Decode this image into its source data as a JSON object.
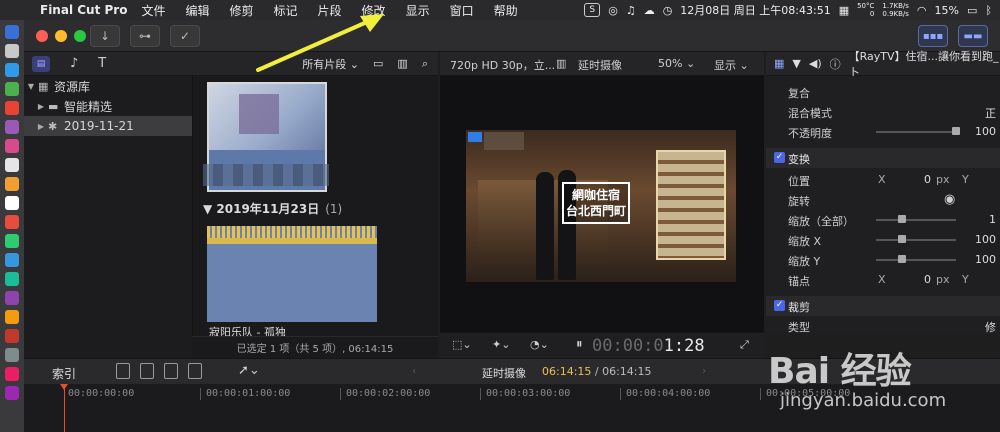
{
  "menubar": {
    "app_name": "Final Cut Pro",
    "items": [
      "文件",
      "编辑",
      "修剪",
      "标记",
      "片段",
      "修改",
      "显示",
      "窗口",
      "帮助"
    ],
    "status": {
      "temp": "50°C",
      "temp2": "0",
      "net_up": "1.7KB/s",
      "net_down": "0.9KB/s",
      "battery": "15%",
      "datetime": "12月08日 周日 上午08:43:51"
    }
  },
  "sidebar": {
    "library_label": "资源库",
    "items": [
      {
        "label": "智能精选"
      },
      {
        "label": "2019-11-21"
      }
    ]
  },
  "browser": {
    "filter_label": "所有片段 ⌄",
    "group_label": "2019年11月23日",
    "group_count": "(1)",
    "clip_name": "寂阳乐队 - 孤独",
    "footer": "已选定 1 项（共 5 项）, 06:14:15"
  },
  "viewer": {
    "format": "720p HD 30p，立...",
    "project_name": "延时摄像",
    "zoom": "50% ⌄",
    "display_label": "显示 ⌄",
    "overlay_line1": "網咖住宿",
    "overlay_line2": "台北西門町",
    "timecode_dim": "00:00:0",
    "timecode_bright": "1:28"
  },
  "inspector": {
    "clip_title": "【RayTV】住宿...讓你看到跑_卜",
    "rows": {
      "composite": "复合",
      "blend_mode": "混合模式",
      "blend_val": "正",
      "opacity": "不透明度",
      "opacity_val": "100",
      "transform": "变换",
      "position": "位置",
      "x_axis": "X",
      "pos_x_val": "0",
      "px": "px",
      "y_axis": "Y",
      "rotation": "旋转",
      "scale_all": "缩放（全部）",
      "scale_all_val": "1",
      "scale_x": "缩放 X",
      "scale_x_val": "100",
      "scale_y": "缩放 Y",
      "scale_y_val": "100",
      "anchor": "锚点",
      "anchor_x_val": "0",
      "crop": "裁剪",
      "type": "类型",
      "type_val": "修"
    }
  },
  "timeline": {
    "index_label": "索引",
    "project_name": "延时摄像",
    "tc_current": "06:14:15",
    "tc_total": "/ 06:14:15",
    "ruler": [
      "00:00:00:00",
      "00:00:01:00:00",
      "00:00:02:00:00",
      "00:00:03:00:00",
      "00:00:04:00:00",
      "00:00:05:00:00"
    ]
  },
  "watermark": {
    "main": "Bai 经验",
    "sub": "jingyan.baidu.com"
  },
  "colors": {
    "accent": "#4b67e8",
    "arrow": "#f2ee3c",
    "playhead": "#e5502b",
    "timecode": "#e7c24d"
  }
}
